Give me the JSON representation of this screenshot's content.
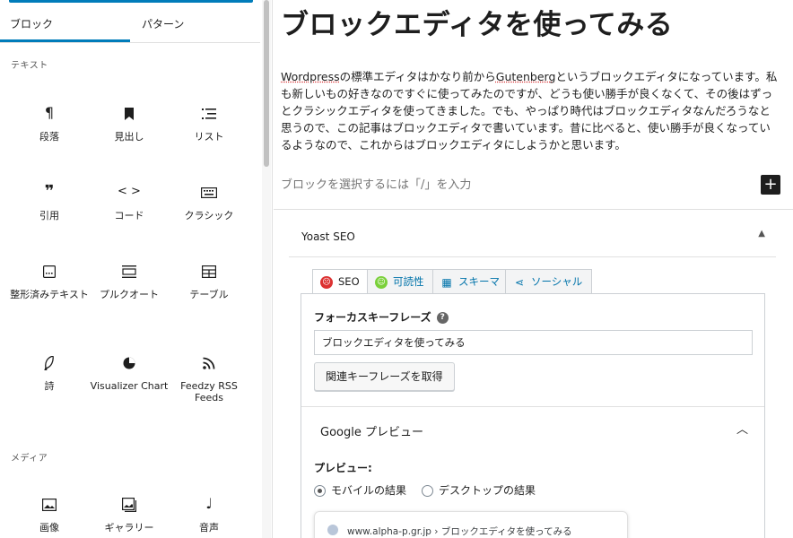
{
  "inserter": {
    "tabs": {
      "blocks": "ブロック",
      "patterns": "パターン"
    },
    "categories": {
      "text": "テキスト",
      "media": "メディア"
    },
    "text_blocks": [
      {
        "label": "段落",
        "icon": "paragraph-icon"
      },
      {
        "label": "見出し",
        "icon": "heading-icon"
      },
      {
        "label": "リスト",
        "icon": "list-icon"
      },
      {
        "label": "引用",
        "icon": "quote-icon"
      },
      {
        "label": "コード",
        "icon": "code-icon"
      },
      {
        "label": "クラシック",
        "icon": "keyboard-icon"
      },
      {
        "label": "整形済みテキスト",
        "icon": "preformatted-icon"
      },
      {
        "label": "プルクオート",
        "icon": "pullquote-icon"
      },
      {
        "label": "テーブル",
        "icon": "table-icon"
      },
      {
        "label": "詩",
        "icon": "verse-icon"
      },
      {
        "label": "Visualizer Chart",
        "icon": "pie-chart-icon"
      },
      {
        "label": "Feedzy RSS Feeds",
        "icon": "rss-icon"
      }
    ],
    "media_blocks": [
      {
        "label": "画像",
        "icon": "image-icon"
      },
      {
        "label": "ギャラリー",
        "icon": "gallery-icon"
      },
      {
        "label": "音声",
        "icon": "audio-icon"
      }
    ]
  },
  "editor": {
    "title": "ブロックエディタを使ってみる",
    "paragraph_spell_1": "Wordpress",
    "paragraph_a": "の標準エディタはかなり前から",
    "paragraph_spell_2": "Gutenberg",
    "paragraph_b": "というブロックエディタになっています。私も新しいもの好きなのですぐに使ってみたのですが、どうも使い勝手が良くなくて、その後はずっとクラシックエディタを使ってきました。でも、やっぱり時代はブロックエディタなんだろうなと思うので、この記事はブロックエディタで書いています。昔に比べると、使い勝手が良くなっているようなので、これからはブロックエディタにしようかと思います。",
    "placeholder": "ブロックを選択するには「/」を入力",
    "add_block": "+"
  },
  "yoast": {
    "title": "Yoast SEO",
    "tabs": [
      "SEO",
      "可読性",
      "スキーマ",
      "ソーシャル"
    ],
    "focus_label": "フォーカスキーフレーズ",
    "focus_value": "ブロックエディタを使ってみる",
    "related_button": "関連キーフレーズを取得",
    "google_preview": "Google プレビュー",
    "preview_label": "プレビュー:",
    "radio_mobile": "モバイルの結果",
    "radio_desktop": "デスクトップの結果",
    "serp_url": "www.alpha-p.gr.jp › ブロックエディタを使ってみる"
  },
  "colors": {
    "accent": "#007cba",
    "seo_red": "#dc3232",
    "readability_green": "#7ad03a"
  }
}
